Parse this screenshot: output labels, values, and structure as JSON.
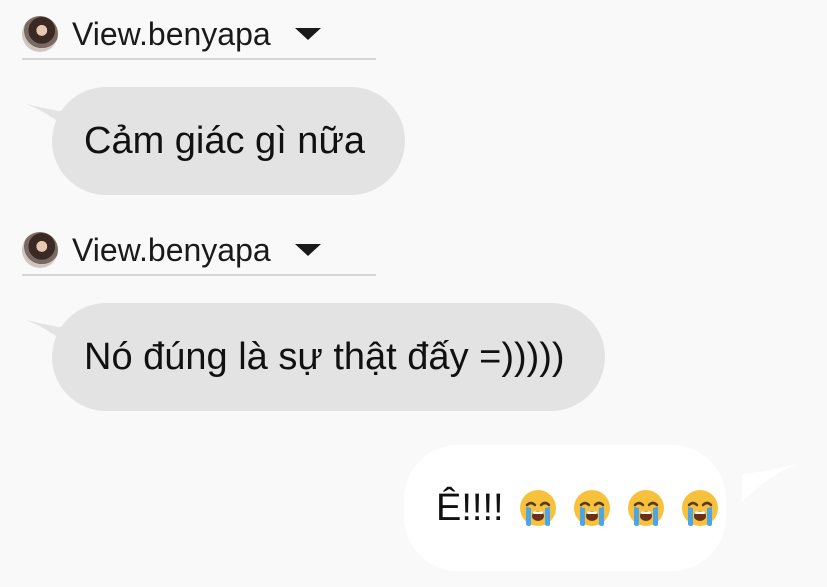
{
  "messages": [
    {
      "sender": "View.benyapa",
      "text": "Cảm giác gì nữa"
    },
    {
      "sender": "View.benyapa",
      "text": "Nó đúng là sự thật đấy =)))))"
    },
    {
      "text": "Ê!!!!",
      "emoji_count": 4,
      "emoji_icon": "loudly-crying-face-icon"
    }
  ],
  "colors": {
    "incoming_bubble": "#e3e3e3",
    "outgoing_bubble": "#ffffff",
    "background": "#f9f9f9"
  }
}
